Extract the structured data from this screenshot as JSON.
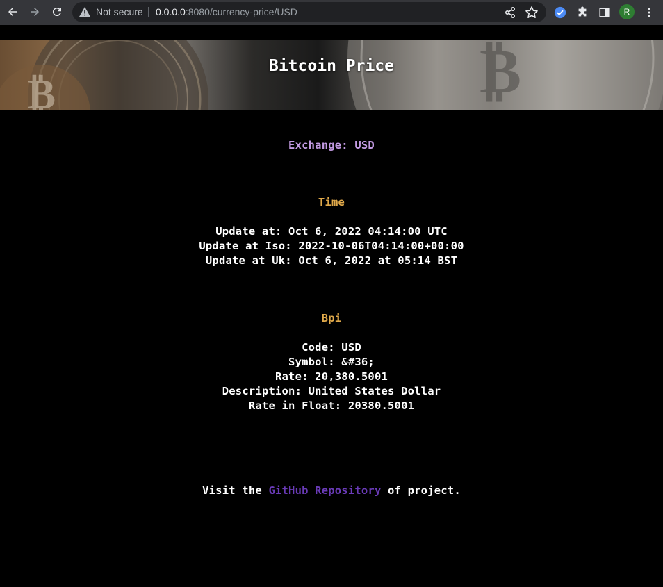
{
  "browser": {
    "security_label": "Not secure",
    "url_host": "0.0.0.0",
    "url_rest": ":8080/currency-price/USD",
    "avatar_letter": "R"
  },
  "banner": {
    "title": "Bitcoin Price"
  },
  "exchange": {
    "label": "Exchange: USD"
  },
  "time": {
    "heading": "Time",
    "update_at": "Update at: Oct 6, 2022 04:14:00 UTC",
    "update_at_iso": "Update at Iso: 2022-10-06T04:14:00+00:00",
    "update_at_uk": "Update at Uk: Oct 6, 2022 at 05:14 BST"
  },
  "bpi": {
    "heading": "Bpi",
    "code": "Code: USD",
    "symbol": "Symbol: &#36;",
    "rate": "Rate: 20,380.5001",
    "description": "Description: United States Dollar",
    "rate_float": "Rate in Float: 20380.5001"
  },
  "footer": {
    "prefix": "Visit the ",
    "link_text": "GitHub Repository",
    "suffix": " of project."
  },
  "colors": {
    "exchange": "#c39be3",
    "heading": "#e0a94a",
    "link": "#6a3bb8"
  }
}
